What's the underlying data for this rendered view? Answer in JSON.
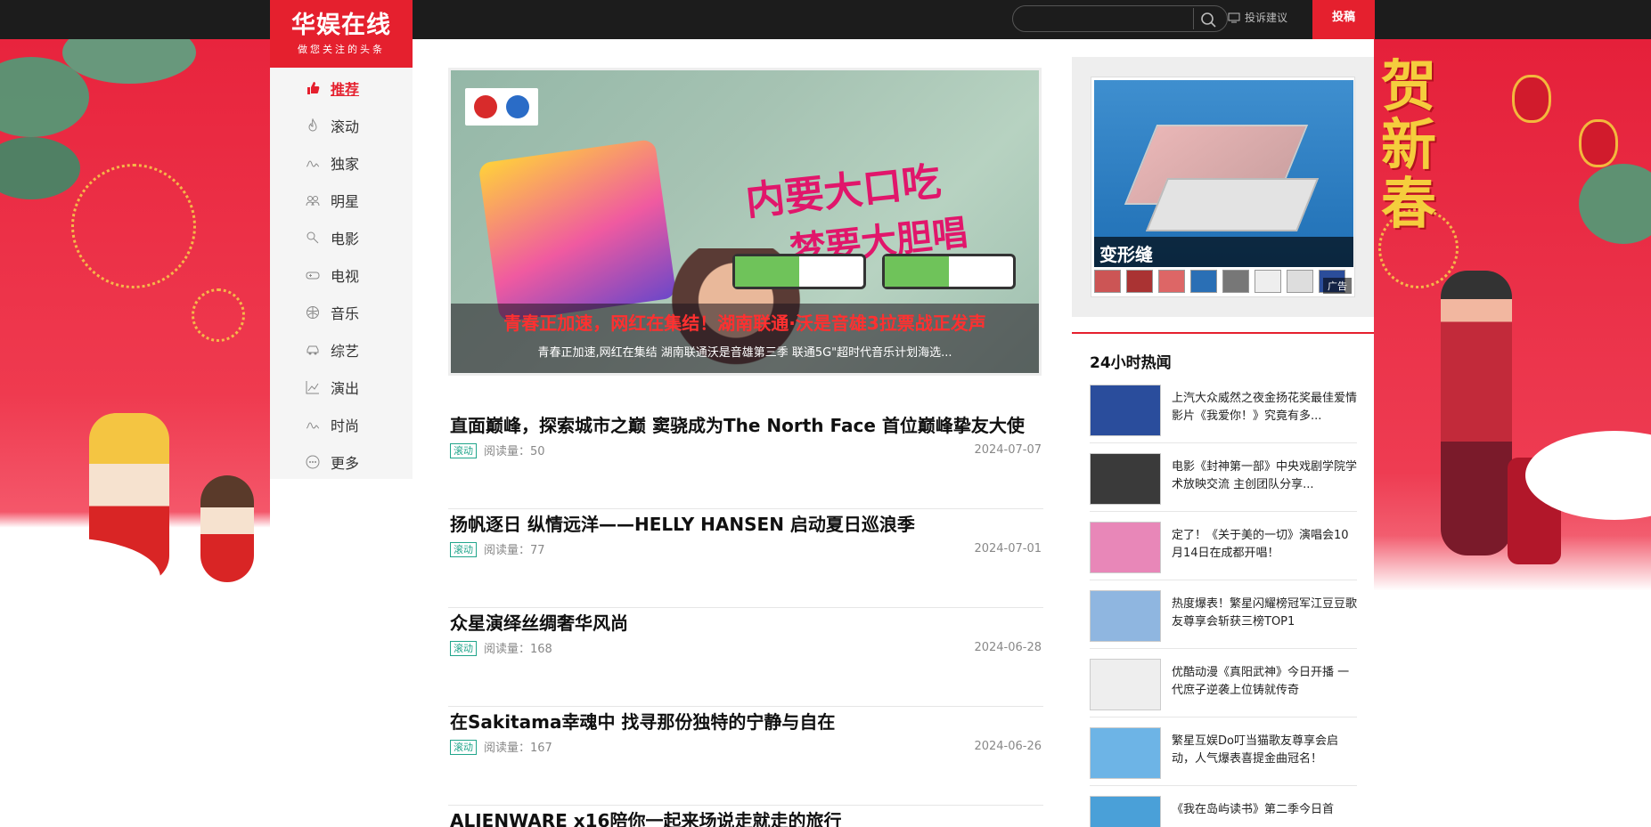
{
  "site": {
    "logo_name": "华娱在线",
    "logo_slogan": "做您关注的头条"
  },
  "topbar": {
    "search_placeholder": "",
    "complaint_label": "投诉建议",
    "submit_label": "投稿"
  },
  "nav": {
    "items": [
      {
        "label": "推荐",
        "icon": "thumbs-up-icon",
        "active": true
      },
      {
        "label": "滚动",
        "icon": "flame-icon"
      },
      {
        "label": "独家",
        "icon": "wave-icon"
      },
      {
        "label": "明星",
        "icon": "people-icon"
      },
      {
        "label": "电影",
        "icon": "film-icon"
      },
      {
        "label": "电视",
        "icon": "gamepad-icon"
      },
      {
        "label": "音乐",
        "icon": "ball-icon"
      },
      {
        "label": "综艺",
        "icon": "car-icon"
      },
      {
        "label": "演出",
        "icon": "chart-icon"
      },
      {
        "label": "时尚",
        "icon": "wave-icon"
      },
      {
        "label": "更多",
        "icon": "more-icon"
      }
    ]
  },
  "banner": {
    "headline": "青春正加速，网红在集结！湖南联通·沃是音雄3拉票战正发声",
    "subline": "青春正加速,网红在集结 湖南联通沃是音雄第三季 联通5G\"超时代音乐计划海选...",
    "art_slogan1": "内要大口吃",
    "art_slogan2": "梦要大胆唱"
  },
  "articles": [
    {
      "title": "直面巅峰，探索城市之巅 窦骁成为The North Face 首位巅峰挚友大使",
      "tag": "滚动",
      "reads": "阅读量：50",
      "date": "2024-07-07"
    },
    {
      "title": "扬帆逐日 纵情远洋——HELLY HANSEN 启动夏日巡浪季",
      "tag": "滚动",
      "reads": "阅读量：77",
      "date": "2024-07-01"
    },
    {
      "title": "众星演绎丝绸奢华风尚",
      "tag": "滚动",
      "reads": "阅读量：168",
      "date": "2024-06-28"
    },
    {
      "title": "在Sakitama幸魂中 找寻那份独特的宁静与自在",
      "tag": "滚动",
      "reads": "阅读量：167",
      "date": "2024-06-26"
    },
    {
      "title": "ALIENWARE x16陪你一起来场说走就走的旅行",
      "tag": "滚动",
      "reads": "",
      "date": ""
    }
  ],
  "ad": {
    "label": "变形缝",
    "badge": "广告"
  },
  "hot": {
    "title": "24小时热闻",
    "items": [
      {
        "text": "上汽大众威然之夜金扬花奖最佳爱情影片《我爱你！》究竟有多...",
        "color": "#2a4d9c"
      },
      {
        "text": "电影《封神第一部》中央戏剧学院学术放映交流 主创团队分享...",
        "color": "#3a3a3a"
      },
      {
        "text": "定了！《关于美的一切》演唱会10月14日在成都开唱！",
        "color": "#e887b8"
      },
      {
        "text": "热度爆表！繁星闪耀榜冠军江豆豆歌友尊享会斩获三榜TOP1",
        "color": "#8fb6e0"
      },
      {
        "text": "优酷动漫《真阳武神》今日开播 一代庶子逆袭上位铸就传奇",
        "color": "#eeeeee"
      },
      {
        "text": "繁星互娱Do叮当猫歌友尊享会启动，人气爆表喜提金曲冠名！",
        "color": "#6db4e6"
      },
      {
        "text": "《我在岛屿读书》第二季今日首",
        "color": "#4aa0d8"
      }
    ]
  },
  "decor": {
    "right_art_text": "贺新春"
  }
}
